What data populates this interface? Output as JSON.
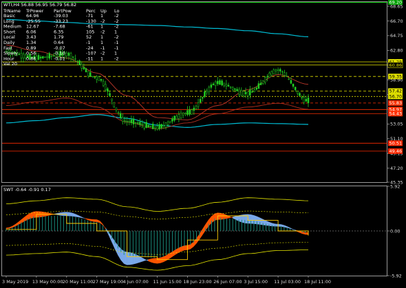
{
  "header": {
    "symbol_line": "WTI,H4 56.88 56.95 56.79 56.82"
  },
  "table": {
    "columns": [
      "TrName",
      "TrPower",
      "PartPow",
      "Perc",
      "Up",
      "Lo"
    ],
    "rows": [
      [
        "Basic",
        "64.96",
        "-39.03",
        "-71",
        "1",
        "-2"
      ],
      [
        "Long",
        "-25.55",
        "-33.23",
        "-130",
        "-2",
        "-2"
      ],
      [
        "Medium",
        "12.67",
        "-7.68",
        "-61",
        "1",
        "-2"
      ],
      [
        "Short",
        "6.06",
        "6.35",
        "105",
        "-2",
        "1"
      ],
      [
        "Local",
        "3.43",
        "1.79",
        "52",
        "1",
        "-2"
      ],
      [
        "Daily",
        "1.34",
        "0.64",
        "-1",
        "1",
        "-1"
      ],
      [
        "Fast",
        "0.89",
        "-0.07",
        "-24",
        "-1",
        "-1"
      ],
      [
        "Slowly",
        "0.56",
        "-0.10",
        "-107",
        "-2",
        "1"
      ],
      [
        "Hour",
        "0.86",
        "-0.01",
        "-11",
        "1",
        "-2"
      ]
    ],
    "footer": "Val 20"
  },
  "sub": {
    "label": "SWT -0.64 -0.91 0.17"
  },
  "price_axis": {
    "ticks": [
      "69.20",
      "68.65",
      "66.70",
      "64.75",
      "62.80",
      "60.85",
      "58.90",
      "56.95",
      "55.00",
      "53.05",
      "51.10",
      "49.15",
      "47.20",
      "45.35"
    ],
    "badges": [
      {
        "label": "69.20",
        "bg": "#00a000",
        "fg": "#fff"
      },
      {
        "label": "61.28",
        "bg": "#e0e000",
        "fg": "#000"
      },
      {
        "label": "60.86",
        "bg": "#000",
        "fg": "#e0e000"
      },
      {
        "label": "59.35",
        "bg": "#e0e000",
        "fg": "#000"
      },
      {
        "label": "57.42",
        "bg": "#e0e000",
        "fg": "#000"
      },
      {
        "label": "56.70",
        "bg": "#e0e000",
        "fg": "#000"
      },
      {
        "label": "55.83",
        "bg": "#ff3000",
        "fg": "#fff"
      },
      {
        "label": "54.97",
        "bg": "#ff3000",
        "fg": "#fff"
      },
      {
        "label": "54.43",
        "bg": "#ff3000",
        "fg": "#fff"
      },
      {
        "label": "50.51",
        "bg": "#ff2a00",
        "fg": "#fff"
      },
      {
        "label": "49.46",
        "bg": "#ff2a00",
        "fg": "#fff"
      }
    ]
  },
  "sub_axis": {
    "ticks": [
      "5.92",
      "0.00",
      "-5.92"
    ]
  },
  "time_axis": {
    "labels": [
      "3 May 2019",
      "13 May 00:00",
      "20 May 11:00",
      "27 May 19:00",
      "4 Jun 07:00",
      "11 Jun 15:00",
      "18 Jun 23:00",
      "26 Jun 07:00",
      "3 Jul 15:00",
      "11 Jul 03:00",
      "18 Jul 11:00"
    ]
  },
  "chart_data": [
    {
      "type": "line",
      "title": "WTI,H4",
      "x": [
        "3 May 2019",
        "13 May 00:00",
        "20 May 11:00",
        "27 May 19:00",
        "4 Jun 07:00",
        "11 Jun 15:00",
        "18 Jun 23:00",
        "26 Jun 07:00",
        "3 Jul 15:00",
        "11 Jul 03:00",
        "18 Jul 11:00"
      ],
      "series": [
        {
          "values": [
            62.6,
            61.8,
            62.3,
            59.2,
            53.4,
            52.6,
            54.5,
            58.5,
            57.1,
            60.2,
            56.1
          ]
        }
      ],
      "ylim": [
        45.35,
        69.2
      ]
    },
    {
      "type": "area",
      "title": "SWT",
      "x": [
        "3 May 2019",
        "13 May 00:00",
        "20 May 11:00",
        "27 May 19:00",
        "4 Jun 07:00",
        "11 Jun 15:00",
        "18 Jun 23:00",
        "26 Jun 07:00",
        "3 Jul 15:00",
        "11 Jul 03:00",
        "18 Jul 11:00"
      ],
      "series": [
        {
          "values": [
            0.4,
            2.6,
            2.0,
            1.5,
            -4.5,
            -3.6,
            -1.9,
            2.4,
            1.0,
            0.6,
            -0.2
          ]
        },
        {
          "values": [
            0.3,
            1.8,
            2.5,
            1.2,
            -2.8,
            -4.3,
            -2.5,
            1.5,
            2.2,
            0.9,
            -0.5
          ]
        }
      ],
      "ylim": [
        -5.92,
        5.92
      ]
    }
  ]
}
